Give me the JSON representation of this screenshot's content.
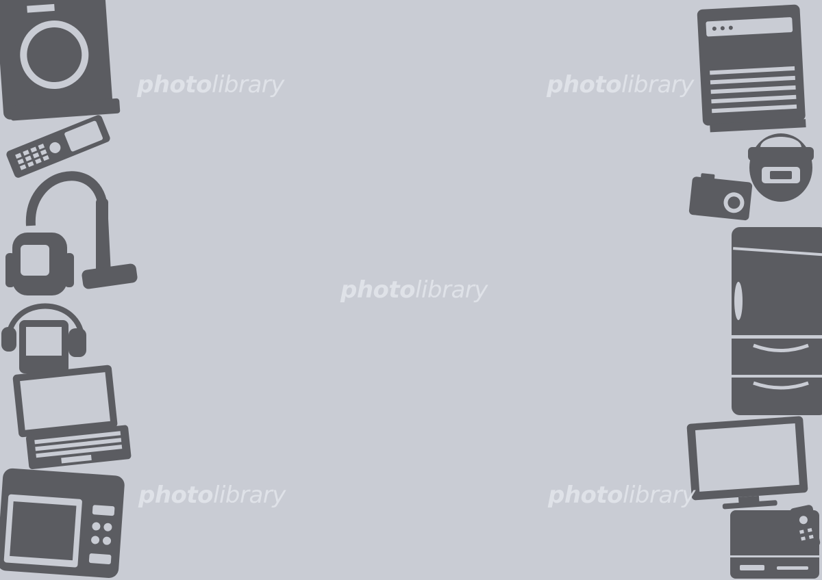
{
  "watermark": {
    "bold": "photo",
    "regular": "library"
  },
  "colors": {
    "background": "#c9ccd4",
    "icons": "#5b5c61",
    "watermark": "#e4e6ec"
  },
  "icons_left": [
    "washing-machine-icon",
    "flip-phone-icon",
    "vacuum-cleaner-icon",
    "music-player-headphones-icon",
    "laptop-icon",
    "microwave-oven-icon"
  ],
  "icons_right": [
    "air-purifier-icon",
    "rice-cooker-icon",
    "digital-camera-icon",
    "refrigerator-icon",
    "flat-tv-icon",
    "video-recorder-icon",
    "remote-control-icon"
  ]
}
